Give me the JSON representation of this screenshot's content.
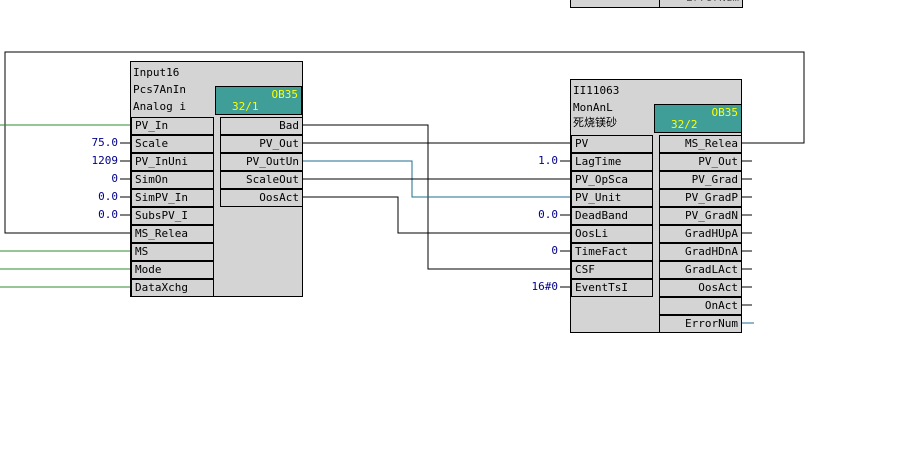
{
  "blocks": {
    "input16": {
      "name": "Input16",
      "type": "Pcs7AnIn",
      "comment": "Analog i",
      "ob": {
        "name": "OB35",
        "num": "32/1"
      },
      "inputs": [
        {
          "label": "PV_In",
          "value": ""
        },
        {
          "label": "Scale",
          "value": "75.0"
        },
        {
          "label": "PV_InUni",
          "value": "1209"
        },
        {
          "label": "SimOn",
          "value": "0"
        },
        {
          "label": "SimPV_In",
          "value": "0.0"
        },
        {
          "label": "SubsPV_I",
          "value": "0.0"
        },
        {
          "label": "MS_Relea",
          "value": ""
        },
        {
          "label": "MS",
          "value": ""
        },
        {
          "label": "Mode",
          "value": ""
        },
        {
          "label": "DataXchg",
          "value": ""
        }
      ],
      "outputs": [
        "Bad",
        "PV_Out",
        "PV_OutUn",
        "ScaleOut",
        "OosAct"
      ]
    },
    "ii11063": {
      "name": "II11063",
      "type": "MonAnL",
      "comment": "死烧镁砂",
      "ob": {
        "name": "OB35",
        "num": "32/2"
      },
      "inputs": [
        {
          "label": "PV",
          "value": ""
        },
        {
          "label": "LagTime",
          "value": "1.0"
        },
        {
          "label": "PV_OpSca",
          "value": ""
        },
        {
          "label": "PV_Unit",
          "value": ""
        },
        {
          "label": "DeadBand",
          "value": "0.0"
        },
        {
          "label": "OosLi",
          "value": ""
        },
        {
          "label": "TimeFact",
          "value": "0"
        },
        {
          "label": "CSF",
          "value": ""
        },
        {
          "label": "EventTsI",
          "value": "16#0"
        }
      ],
      "outputs": [
        "MS_Relea",
        "PV_Out",
        "PV_Grad",
        "PV_GradP",
        "PV_GradN",
        "GradHUpA",
        "GradHDnA",
        "GradLAct",
        "OosAct",
        "OnAct",
        "ErrorNum"
      ]
    },
    "top_partial": {
      "output_label": "ErrorNum"
    }
  },
  "colors": {
    "block_fill": "#d4d4d4",
    "ob_fill": "#3f9e98",
    "ob_text": "#ffff00",
    "value_text": "#00008b",
    "wire_black": "#000000",
    "wire_green": "#2e8b2e",
    "wire_blue": "#1e6e8c"
  }
}
